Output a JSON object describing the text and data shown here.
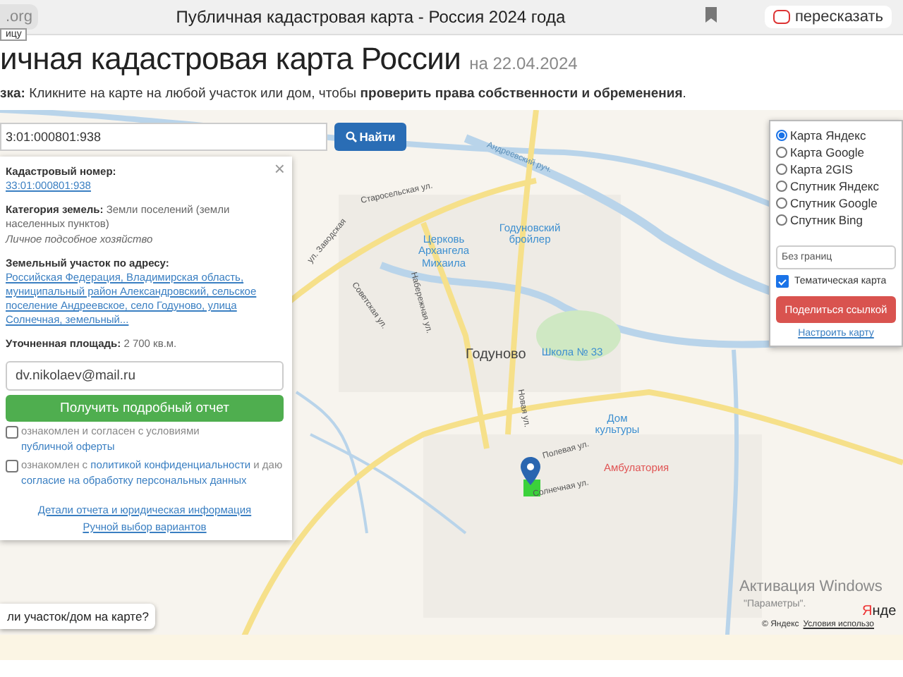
{
  "browser": {
    "address": ".org",
    "tooltip": "ицу",
    "title": "Публичная кадастровая карта - Россия 2024 года",
    "retell_button": "пересказать"
  },
  "header": {
    "title": "ичная кадастровая карта России",
    "date": "на 22.04.2024",
    "hint": "**зка:** Кликните на карте на любой участок или дом, чтобы **проверить права собственности и обременения**."
  },
  "search": {
    "value": "3:01:000801:938",
    "button": "Найти"
  },
  "info_panel": {
    "close": "×",
    "fields": [
      {
        "label": "Кадастровый номер:",
        "kind": "link",
        "value": "33:01:000801:938"
      },
      {
        "label": "Категория земель:",
        "kind": "text",
        "value": "Земли поселений (земли населенных пунктов)",
        "note": "Личное подсобное хозяйство"
      },
      {
        "label": "Земельный участок по адресу:",
        "kind": "link",
        "value": "Российская Федерация, Владимирская область, муниципальный район Александровский, сельское поселение Андреевское, село Годуново, улица Солнечная, земельный..."
      },
      {
        "label": "Уточненная площадь:",
        "kind": "text",
        "value": "2 700 кв.м."
      }
    ],
    "email": {
      "value": "dv.nikolaev@mail.ru"
    },
    "report_button": "Получить подробный отчет",
    "agreements": [
      {
        "checked": false,
        "parts": [
          {
            "kind": "text",
            "text": "ознакомлен и согласен с условиями "
          },
          {
            "kind": "link",
            "text": "публичной оферты"
          }
        ]
      },
      {
        "checked": false,
        "parts": [
          {
            "kind": "text",
            "text": "ознакомлен с "
          },
          {
            "kind": "link",
            "text": "политикой конфиденциальности"
          },
          {
            "kind": "text",
            "text": " и даю "
          },
          {
            "kind": "link",
            "text": "согласие на обработку персональных данных"
          }
        ]
      }
    ],
    "links": [
      "Детали отчета и юридическая информация",
      "Ручной выбор вариантов"
    ]
  },
  "layers": {
    "options": [
      {
        "label": "Карта Яндекс",
        "selected": true
      },
      {
        "label": "Карта Google",
        "selected": false
      },
      {
        "label": "Карта 2GIS",
        "selected": false
      },
      {
        "label": "Спутник Яндекс",
        "selected": false
      },
      {
        "label": "Спутник Google",
        "selected": false
      },
      {
        "label": "Спутник Bing",
        "selected": false
      }
    ],
    "boundaries": "Без границ",
    "thematic": {
      "label": "Тематическая карта",
      "checked": true
    },
    "share_button": "Поделиться ссылкой",
    "settings_link": "Настроить карту"
  },
  "map_labels": [
    {
      "text": "Андреевский руч.",
      "kind": "water"
    },
    {
      "text": "Старосельская ул.",
      "kind": "street"
    },
    {
      "text": "Церковь Архангела Михаила",
      "kind": "poi"
    },
    {
      "text": "Годуновский бройлер",
      "kind": "poi"
    },
    {
      "text": "ул. Заводская",
      "kind": "street"
    },
    {
      "text": "Советская ул.",
      "kind": "street"
    },
    {
      "text": "Набережная ул.",
      "kind": "street"
    },
    {
      "text": "Годуново",
      "kind": "place"
    },
    {
      "text": "Школа № 33",
      "kind": "poi"
    },
    {
      "text": "Новая ул.",
      "kind": "street"
    },
    {
      "text": "Дом культуры",
      "kind": "poi"
    },
    {
      "text": "Полевая ул.",
      "kind": "street"
    },
    {
      "text": "Амбулатория",
      "kind": "medical"
    },
    {
      "text": "Солнечная ул.",
      "kind": "street"
    }
  ],
  "find_button": "ли участок/дом на карте?",
  "map_footer": {
    "copyright": "© Яндекс",
    "terms": "Условия использо",
    "logo": "Янде"
  },
  "os_notice": {
    "title": "Активация Windows",
    "hint": "\"Параметры\"."
  }
}
